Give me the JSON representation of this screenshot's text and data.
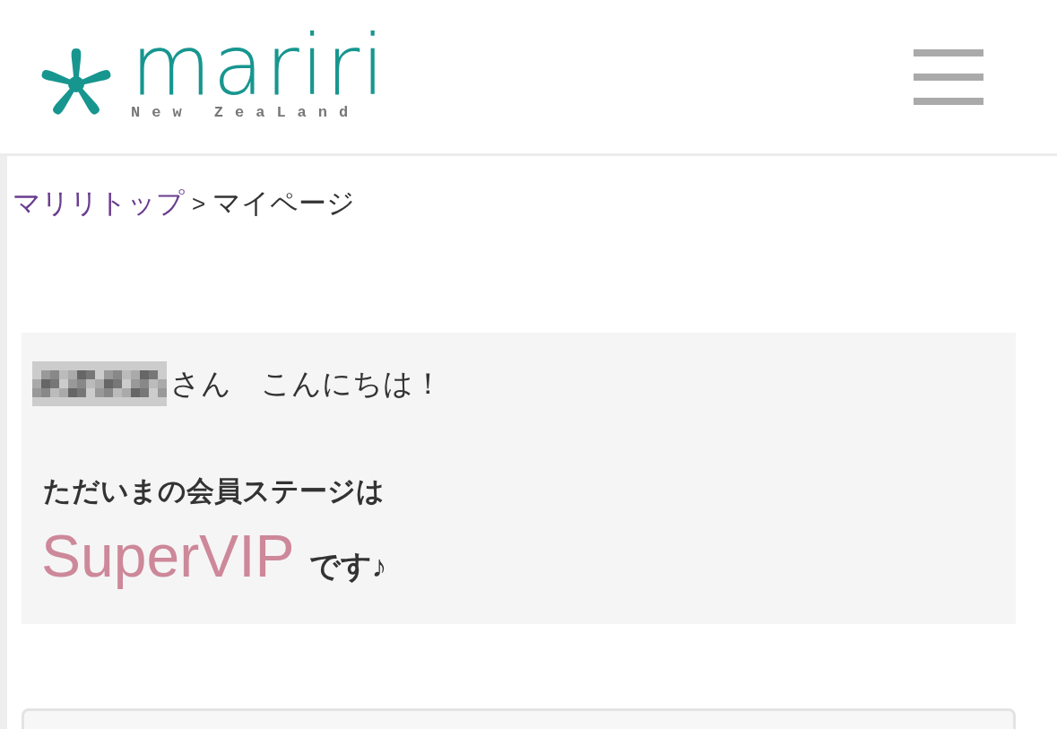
{
  "header": {
    "logo": {
      "wordmark": "mariri",
      "tagline": "New ZeaLand"
    }
  },
  "breadcrumb": {
    "separator": ">",
    "items": [
      {
        "label": "マリリトップ",
        "kind": "link"
      },
      {
        "label": "マイページ",
        "kind": "current"
      }
    ]
  },
  "welcome": {
    "greeting": "さん　こんにちは！",
    "stage_label": "ただいまの会員ステージは",
    "stage": "SuperVIP",
    "stage_suffix": "です♪"
  }
}
